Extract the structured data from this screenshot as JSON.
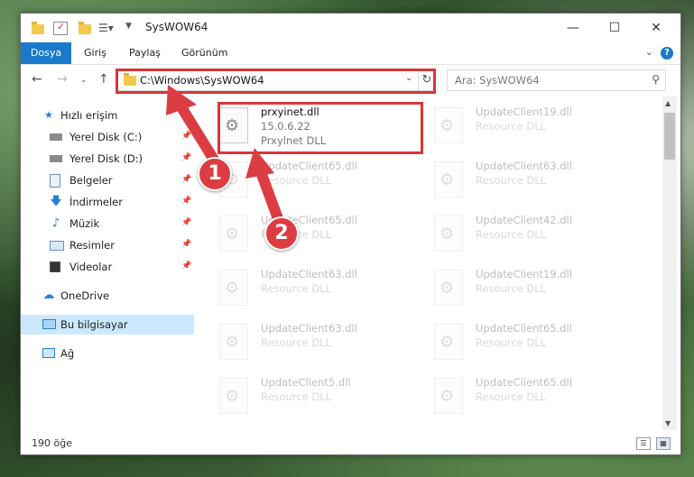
{
  "window": {
    "title": "SysWOW64",
    "controls": {
      "minimize": "—",
      "maximize": "☐",
      "close": "✕"
    }
  },
  "ribbon": {
    "tabs": [
      "Dosya",
      "Giriş",
      "Paylaş",
      "Görünüm"
    ],
    "help": "?"
  },
  "nav": {
    "address": "C:\\Windows\\SysWOW64",
    "search_placeholder": "Ara: SysWOW64"
  },
  "sidebar": {
    "items": [
      {
        "label": "Hızlı erişim",
        "icon": "star-icon"
      },
      {
        "label": "Yerel Disk (C:)",
        "icon": "drive-icon"
      },
      {
        "label": "Yerel Disk (D:)",
        "icon": "drive-icon"
      },
      {
        "label": "Belgeler",
        "icon": "documents-icon"
      },
      {
        "label": "İndirmeler",
        "icon": "download-icon"
      },
      {
        "label": "Müzik",
        "icon": "music-icon"
      },
      {
        "label": "Resimler",
        "icon": "pictures-icon"
      },
      {
        "label": "Videolar",
        "icon": "videos-icon"
      },
      {
        "label": "OneDrive",
        "icon": "cloud-icon"
      },
      {
        "label": "Bu bilgisayar",
        "icon": "computer-icon"
      },
      {
        "label": "Ağ",
        "icon": "network-icon"
      }
    ]
  },
  "files": [
    {
      "name": "prxyinet.dll",
      "version": "15.0.6.22",
      "description": "Prxylnet DLL"
    },
    {
      "name": "UpdateClient19.dll",
      "description": "Resource DLL"
    },
    {
      "name": "UpdateClient65.dll",
      "description": "Resource DLL"
    },
    {
      "name": "UpdateClient63.dll",
      "description": "Resource DLL"
    },
    {
      "name": "UpdateClient65.dll",
      "description": "Resource DLL"
    },
    {
      "name": "UpdateClient42.dll",
      "description": "Resource DLL"
    },
    {
      "name": "UpdateClient63.dll",
      "description": "Resource DLL"
    },
    {
      "name": "UpdateClient19.dll",
      "description": "Resource DLL"
    },
    {
      "name": "UpdateClient63.dll",
      "description": "Resource DLL"
    },
    {
      "name": "UpdateClient65.dll",
      "description": "Resource DLL"
    },
    {
      "name": "UpdateClient5.dll",
      "description": "Resource DLL"
    },
    {
      "name": "UpdateClient65.dll",
      "description": "Resource DLL"
    }
  ],
  "status": {
    "count": "190 öğe"
  },
  "annotations": {
    "marker1": "1",
    "marker2": "2",
    "color": "#dc3d43"
  }
}
